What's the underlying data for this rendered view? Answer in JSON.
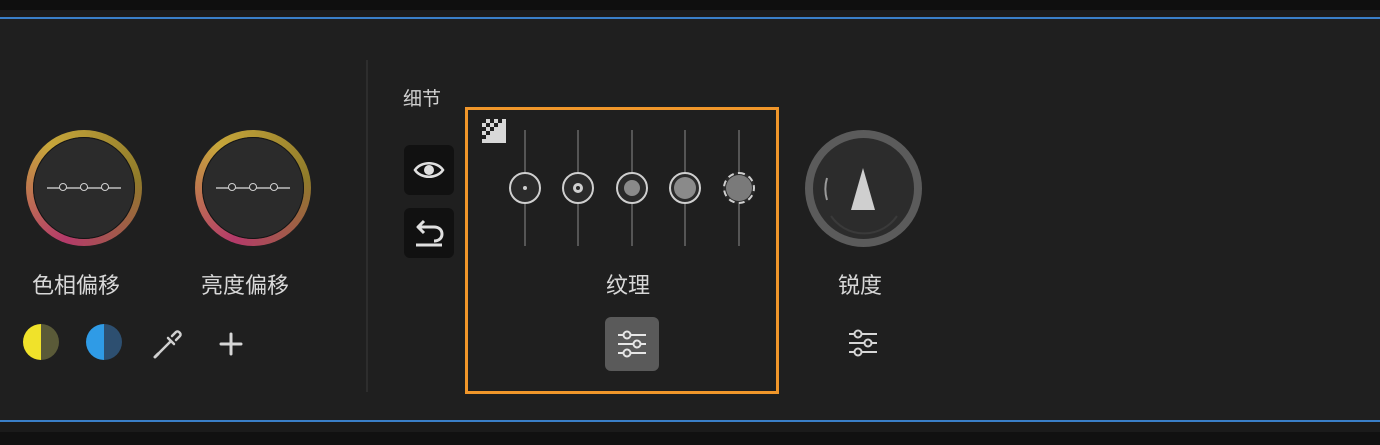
{
  "wheels": [
    {
      "label": "色相偏移"
    },
    {
      "label": "亮度偏移"
    }
  ],
  "swatches": {
    "yellow": {
      "left": "#f0e22a",
      "right": "#5a5a38"
    },
    "blue": {
      "left": "#2f9be6",
      "right": "#2d4f70"
    }
  },
  "detail": {
    "title": "细节",
    "texture_label": "纹理",
    "sharpness_label": "锐度",
    "slider_count": 5
  },
  "accent": {
    "highlight": "#f0962a",
    "divider_blue": "#3a7fc8"
  }
}
